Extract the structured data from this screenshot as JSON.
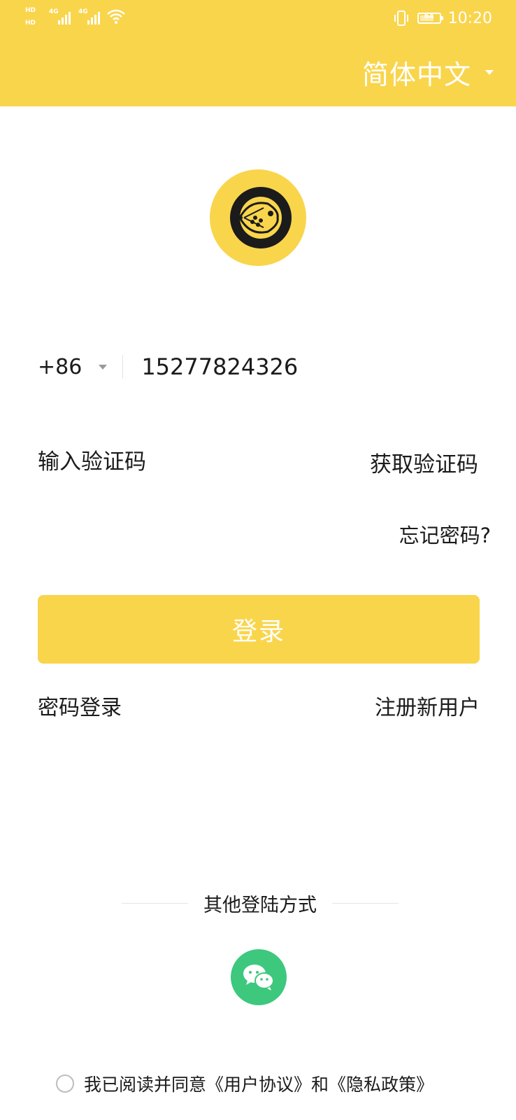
{
  "status_bar": {
    "left_badge_top": "HD",
    "left_badge_bottom": "HD",
    "network_1": "4G",
    "network_2": "4G",
    "battery_level": "64",
    "time": "10:20"
  },
  "header": {
    "language": "简体中文"
  },
  "form": {
    "country_code": "+86",
    "phone_value": "15277824326",
    "code_placeholder": "输入验证码",
    "get_code_label": "获取验证码",
    "forgot_label": "忘记密码?"
  },
  "login_button": "登录",
  "links": {
    "password_login": "密码登录",
    "register": "注册新用户"
  },
  "other_login": {
    "label": "其他登陆方式",
    "wechat_icon": "wechat-icon"
  },
  "agreement": {
    "text": "我已阅读并同意《用户协议》和《隐私政策》"
  },
  "colors": {
    "brand": "#f9d54c",
    "wechat": "#3dc87d"
  }
}
